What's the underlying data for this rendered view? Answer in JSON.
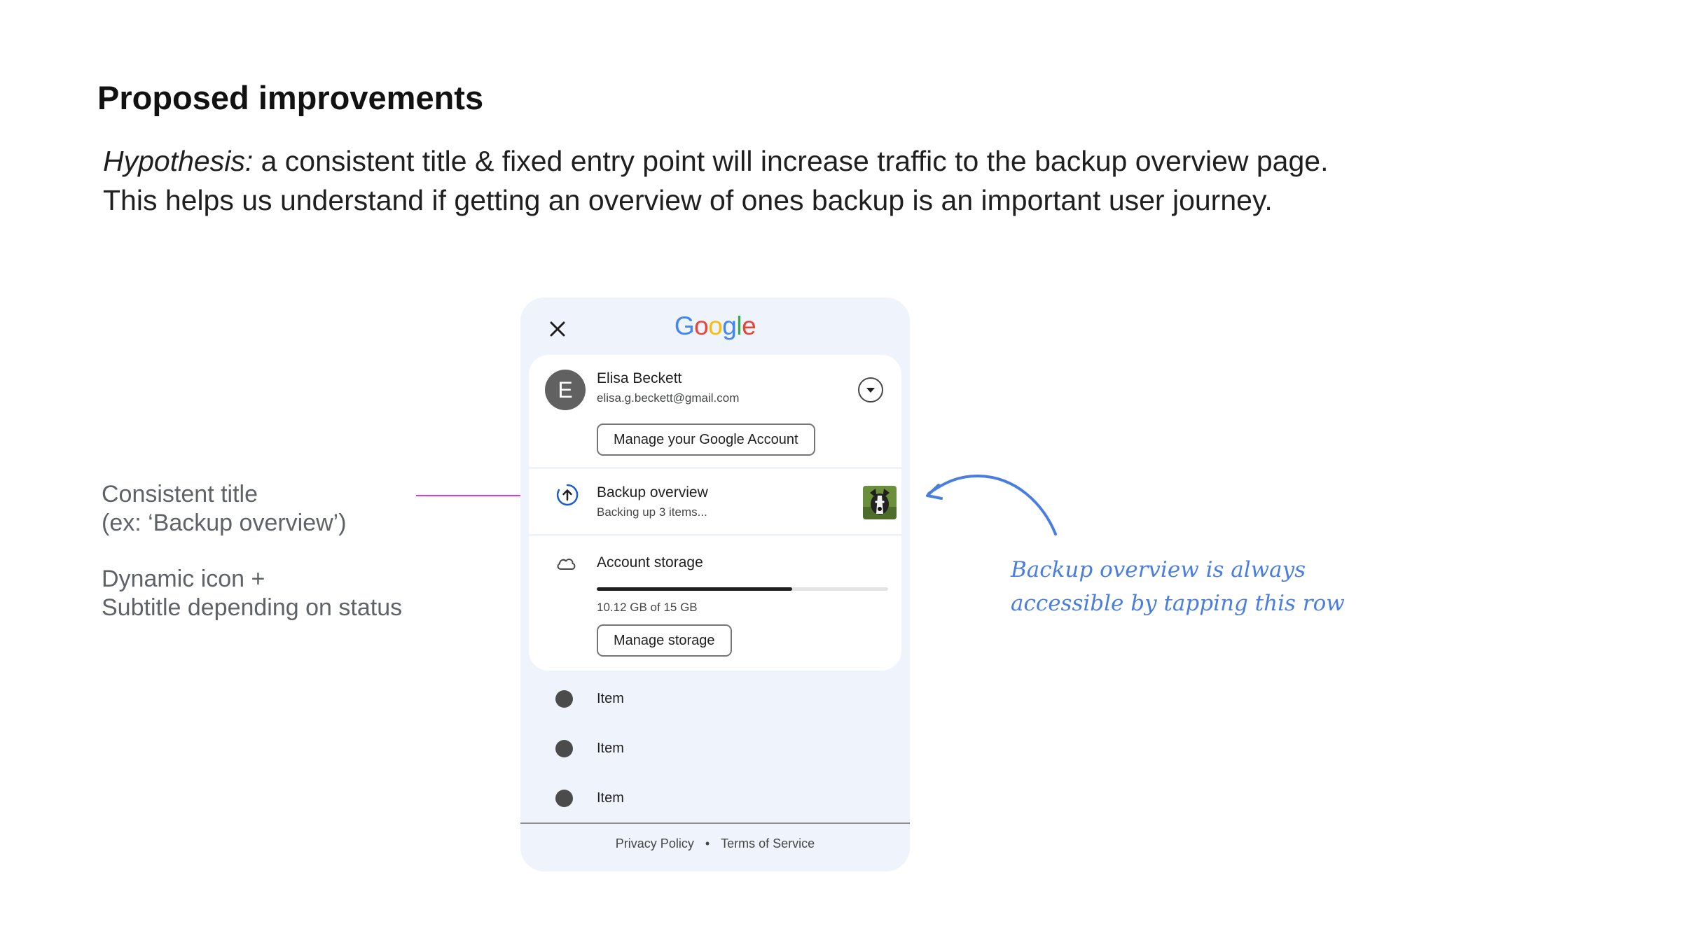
{
  "slide": {
    "title": "Proposed improvements",
    "hypothesis_label": "Hypothesis:",
    "hypothesis_text": " a consistent title & fixed entry point will increase traffic to the backup overview page.",
    "hypothesis_line2": "This helps us understand if getting an overview of ones backup is an important user journey."
  },
  "annotations": {
    "consistent_title_line1": "Consistent title",
    "consistent_title_line2": "(ex: ‘Backup overview’)",
    "dynamic_icon_line1": "Dynamic icon +",
    "dynamic_icon_line2": "Subtitle depending on status",
    "handwritten_line1": "Backup overview is always",
    "handwritten_line2": "accessible by tapping this row",
    "pointer_color": "#d63be0",
    "handwritten_color": "#4a7de0"
  },
  "phone": {
    "logo": [
      "G",
      "o",
      "o",
      "g",
      "l",
      "e"
    ],
    "close_icon": "close-icon",
    "account": {
      "avatar_letter": "E",
      "name": "Elisa Beckett",
      "email": "elisa.g.beckett@gmail.com",
      "manage_button": "Manage your Google Account",
      "switch_icon": "chevron-down-icon"
    },
    "backup": {
      "title": "Backup overview",
      "subtitle": "Backing up 3 items...",
      "icon": "backup-upload-icon",
      "thumbnail": "dog-photo"
    },
    "storage": {
      "title": "Account storage",
      "usage": "10.12 GB of 15 GB",
      "used_fraction": 0.67,
      "manage_button": "Manage storage",
      "icon": "cloud-icon"
    },
    "menu_items": [
      {
        "label": "Item"
      },
      {
        "label": "Item"
      },
      {
        "label": "Item"
      }
    ],
    "footer": {
      "privacy": "Privacy Policy",
      "separator": "•",
      "terms": "Terms of Service"
    }
  }
}
